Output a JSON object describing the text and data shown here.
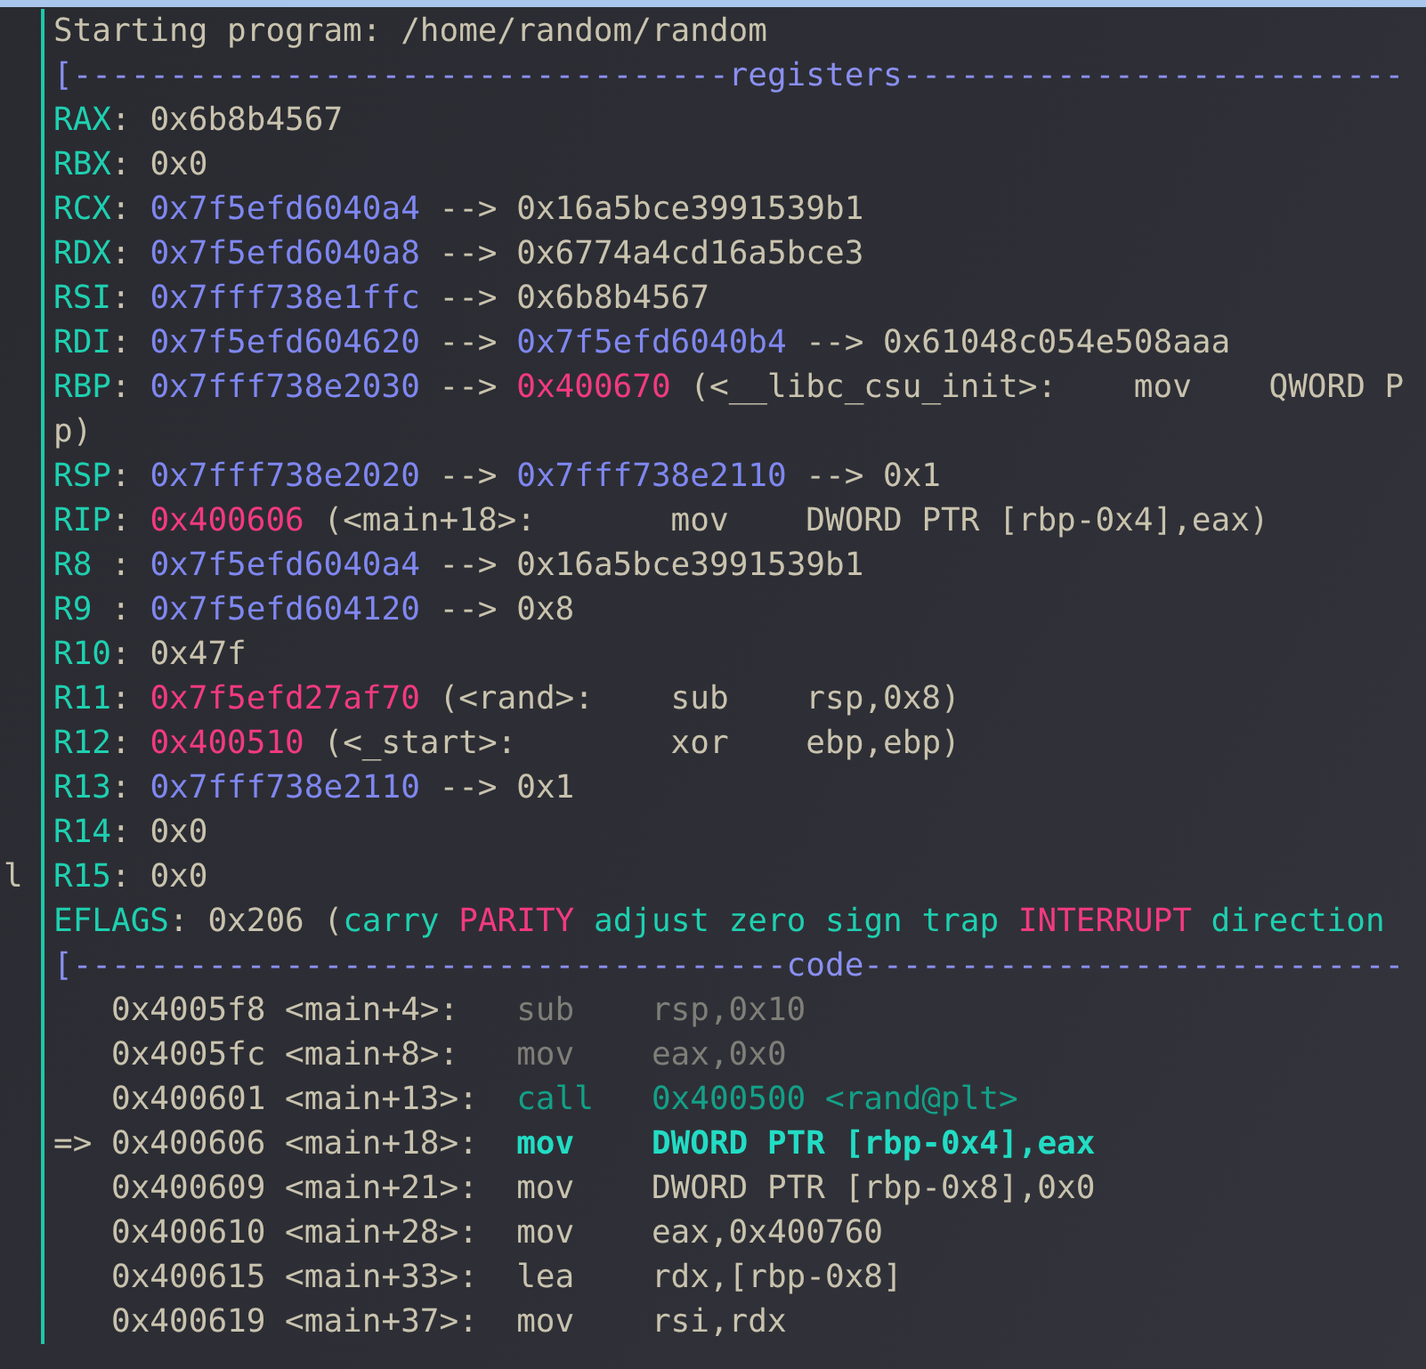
{
  "lines": [
    {
      "segments": [
        {
          "text": "Starting program: /home/random/random",
          "kind": "plain"
        }
      ]
    },
    {
      "segments": [
        {
          "text": "[----------------------------------registers--------------------------",
          "kind": "header"
        }
      ]
    },
    {
      "segments": [
        {
          "text": "RAX",
          "kind": "reg"
        },
        {
          "text": ": 0x6b8b4567",
          "kind": "plain"
        }
      ]
    },
    {
      "segments": [
        {
          "text": "RBX",
          "kind": "reg"
        },
        {
          "text": ": 0x0",
          "kind": "plain"
        }
      ]
    },
    {
      "segments": [
        {
          "text": "RCX",
          "kind": "reg"
        },
        {
          "text": ": ",
          "kind": "plain"
        },
        {
          "text": "0x7f5efd6040a4",
          "kind": "addr"
        },
        {
          "text": " --> 0x16a5bce3991539b1",
          "kind": "plain"
        }
      ]
    },
    {
      "segments": [
        {
          "text": "RDX",
          "kind": "reg"
        },
        {
          "text": ": ",
          "kind": "plain"
        },
        {
          "text": "0x7f5efd6040a8",
          "kind": "addr"
        },
        {
          "text": " --> 0x6774a4cd16a5bce3",
          "kind": "plain"
        }
      ]
    },
    {
      "segments": [
        {
          "text": "RSI",
          "kind": "reg"
        },
        {
          "text": ": ",
          "kind": "plain"
        },
        {
          "text": "0x7fff738e1ffc",
          "kind": "addr"
        },
        {
          "text": " --> 0x6b8b4567",
          "kind": "plain"
        }
      ]
    },
    {
      "segments": [
        {
          "text": "RDI",
          "kind": "reg"
        },
        {
          "text": ": ",
          "kind": "plain"
        },
        {
          "text": "0x7f5efd604620",
          "kind": "addr"
        },
        {
          "text": " --> ",
          "kind": "plain"
        },
        {
          "text": "0x7f5efd6040b4",
          "kind": "addr"
        },
        {
          "text": " --> 0x61048c054e508aaa",
          "kind": "plain"
        }
      ]
    },
    {
      "segments": [
        {
          "text": "RBP",
          "kind": "reg"
        },
        {
          "text": ": ",
          "kind": "plain"
        },
        {
          "text": "0x7fff738e2030",
          "kind": "addr"
        },
        {
          "text": " --> ",
          "kind": "plain"
        },
        {
          "text": "0x400670",
          "kind": "code"
        },
        {
          "text": " (<__libc_csu_init>:    mov    QWORD P",
          "kind": "plain"
        }
      ]
    },
    {
      "segments": [
        {
          "text": "p)",
          "kind": "plain"
        }
      ]
    },
    {
      "segments": [
        {
          "text": "RSP",
          "kind": "reg"
        },
        {
          "text": ": ",
          "kind": "plain"
        },
        {
          "text": "0x7fff738e2020",
          "kind": "addr"
        },
        {
          "text": " --> ",
          "kind": "plain"
        },
        {
          "text": "0x7fff738e2110",
          "kind": "addr"
        },
        {
          "text": " --> 0x1",
          "kind": "plain"
        }
      ]
    },
    {
      "segments": [
        {
          "text": "RIP",
          "kind": "reg"
        },
        {
          "text": ": ",
          "kind": "plain"
        },
        {
          "text": "0x400606",
          "kind": "code"
        },
        {
          "text": " (<main+18>:       mov    DWORD PTR [rbp-0x4],eax)",
          "kind": "plain"
        }
      ]
    },
    {
      "segments": [
        {
          "text": "R8 ",
          "kind": "reg"
        },
        {
          "text": ": ",
          "kind": "plain"
        },
        {
          "text": "0x7f5efd6040a4",
          "kind": "addr"
        },
        {
          "text": " --> 0x16a5bce3991539b1",
          "kind": "plain"
        }
      ]
    },
    {
      "segments": [
        {
          "text": "R9 ",
          "kind": "reg"
        },
        {
          "text": ": ",
          "kind": "plain"
        },
        {
          "text": "0x7f5efd604120",
          "kind": "addr"
        },
        {
          "text": " --> 0x8",
          "kind": "plain"
        }
      ]
    },
    {
      "segments": [
        {
          "text": "R10",
          "kind": "reg"
        },
        {
          "text": ": 0x47f",
          "kind": "plain"
        }
      ]
    },
    {
      "segments": [
        {
          "text": "R11",
          "kind": "reg"
        },
        {
          "text": ": ",
          "kind": "plain"
        },
        {
          "text": "0x7f5efd27af70",
          "kind": "code"
        },
        {
          "text": " (<rand>:    sub    rsp,0x8)",
          "kind": "plain"
        }
      ]
    },
    {
      "segments": [
        {
          "text": "R12",
          "kind": "reg"
        },
        {
          "text": ": ",
          "kind": "plain"
        },
        {
          "text": "0x400510",
          "kind": "code"
        },
        {
          "text": " (<_start>:        xor    ebp,ebp)",
          "kind": "plain"
        }
      ]
    },
    {
      "segments": [
        {
          "text": "R13",
          "kind": "reg"
        },
        {
          "text": ": ",
          "kind": "plain"
        },
        {
          "text": "0x7fff738e2110",
          "kind": "addr"
        },
        {
          "text": " --> 0x1",
          "kind": "plain"
        }
      ]
    },
    {
      "segments": [
        {
          "text": "R14",
          "kind": "reg"
        },
        {
          "text": ": 0x0",
          "kind": "plain"
        }
      ]
    },
    {
      "gutter": "l",
      "segments": [
        {
          "text": "R15",
          "kind": "reg"
        },
        {
          "text": ": 0x0",
          "kind": "plain"
        }
      ]
    },
    {
      "segments": [
        {
          "text": "EFLAGS",
          "kind": "reg"
        },
        {
          "text": ": 0x206 (",
          "kind": "plain"
        },
        {
          "text": "carry ",
          "kind": "flag"
        },
        {
          "text": "PARITY",
          "kind": "flagon"
        },
        {
          "text": " adjust zero sign trap ",
          "kind": "flag"
        },
        {
          "text": "INTERRUPT",
          "kind": "flagon"
        },
        {
          "text": " direction",
          "kind": "flag"
        }
      ]
    },
    {
      "segments": [
        {
          "text": "[-------------------------------------code----------------------------",
          "kind": "header"
        }
      ]
    },
    {
      "segments": [
        {
          "text": "   0x4005f8 <main+4>:   ",
          "kind": "plain"
        },
        {
          "text": "sub    rsp,0x10",
          "kind": "dim"
        }
      ]
    },
    {
      "segments": [
        {
          "text": "   0x4005fc <main+8>:   ",
          "kind": "plain"
        },
        {
          "text": "mov    eax,0x0",
          "kind": "dim"
        }
      ]
    },
    {
      "segments": [
        {
          "text": "   0x400601 <main+13>:  ",
          "kind": "plain"
        },
        {
          "text": "call   0x400500 <rand@plt>",
          "kind": "call"
        }
      ]
    },
    {
      "segments": [
        {
          "text": "=> 0x400606 <main+18>:  ",
          "kind": "plain"
        },
        {
          "text": "mov    DWORD PTR [rbp-0x4],eax",
          "kind": "current"
        }
      ]
    },
    {
      "segments": [
        {
          "text": "   0x400609 <main+21>:  mov    DWORD PTR [rbp-0x8],0x0",
          "kind": "plain"
        }
      ]
    },
    {
      "segments": [
        {
          "text": "   0x400610 <main+28>:  mov    eax,0x400760",
          "kind": "plain"
        }
      ]
    },
    {
      "segments": [
        {
          "text": "   0x400615 <main+33>:  lea    rdx,[rbp-0x8]",
          "kind": "plain"
        }
      ]
    },
    {
      "segments": [
        {
          "text": "   0x400619 <main+37>:  mov    rsi,rdx",
          "kind": "plain"
        }
      ]
    }
  ]
}
